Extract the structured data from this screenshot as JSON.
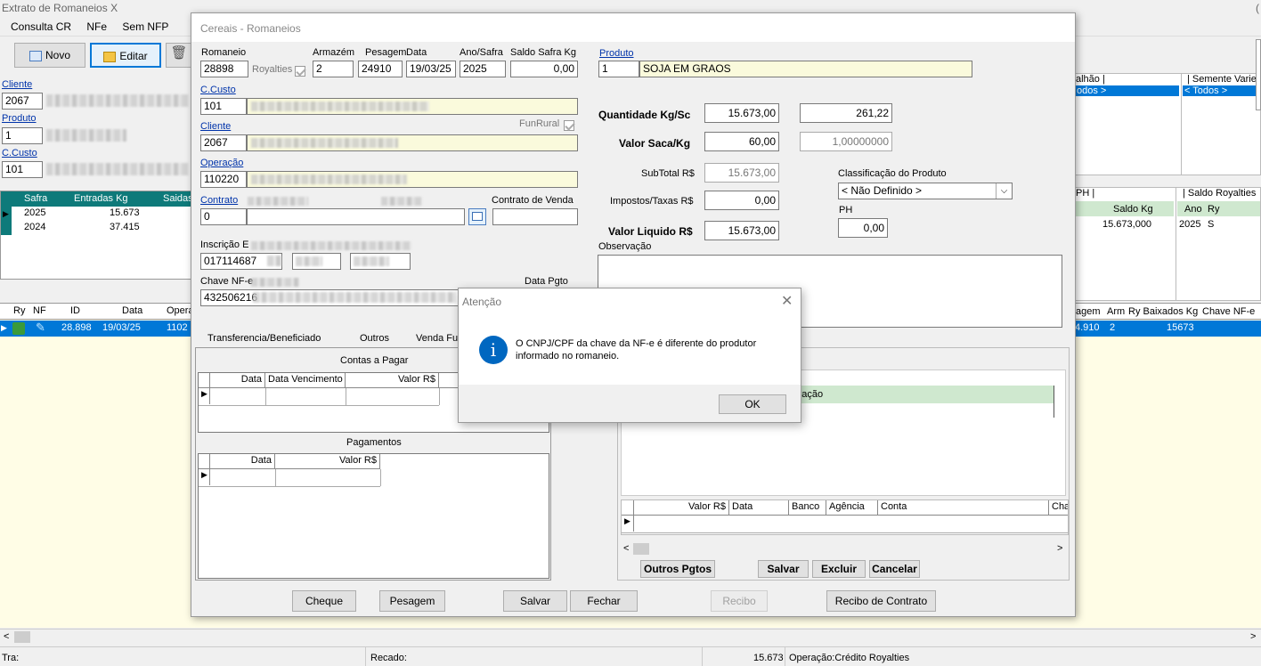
{
  "main": {
    "title": "Extrato de Romaneios X",
    "menu": [
      "Consulta CR",
      "NFe",
      "Sem NFP"
    ],
    "btn_novo": "Novo",
    "btn_editar": "Editar",
    "cliente_label": "Cliente",
    "cliente_code": "2067",
    "produto_label": "Produto",
    "produto_code": "1",
    "ccusto_label": "C.Custo",
    "ccusto_code": "101",
    "safra_headers": [
      "Safra",
      "Entradas Kg",
      "Saidas"
    ],
    "safra_rows": [
      [
        "2025",
        "15.673"
      ],
      [
        "2024",
        "37.415"
      ]
    ],
    "grid_headers": [
      "Ry",
      "NF",
      "ID",
      "Data",
      "Opera"
    ],
    "grid_row": [
      "28.898",
      "19/03/25",
      "1102"
    ],
    "right_hdr_talhao": "alhão |",
    "right_hdr_semente": "| Semente Varie",
    "right_todos1": "odos >",
    "right_todos2": "< Todos >",
    "right_ph": "PH |",
    "right_saldo_roy": "| Saldo Royalties",
    "right_saldo_kg": "Saldo Kg",
    "right_ano": "Ano",
    "right_ry": "Ry",
    "right_saldo_val": "15.673,000",
    "right_ano_val": "2025",
    "right_ry_val": "S",
    "right_grid_headers": [
      "agem",
      "Arm",
      "Ry Baixados Kg",
      "Chave NF-e"
    ],
    "right_grid_row": [
      "4.910",
      "2",
      "15673"
    ],
    "status_tra": "Tra:",
    "status_recado": "Recado:",
    "status_qty": "15.673",
    "status_oper": "Operação:Crédito Royalties"
  },
  "win": {
    "title": "Cereais - Romaneios",
    "romaneio_label": "Romaneio",
    "romaneio": "28898",
    "royalties_label": "Royalties",
    "armazem_label": "Armazém",
    "armazem": "2",
    "pesagem_label": "Pesagem",
    "pesagem": "24910",
    "data_label": "Data",
    "data": "19/03/25",
    "anosafra_label": "Ano/Safra",
    "anosafra": "2025",
    "saldo_label": "Saldo Safra Kg",
    "saldo": "0,00",
    "ccusto_label": "C.Custo",
    "ccusto": "101",
    "cliente_label": "Cliente",
    "cliente": "2067",
    "funrural_label": "FunRural",
    "operacao_label": "Operação",
    "operacao": "110220",
    "contrato_label": "Contrato",
    "contrato": "0",
    "contrato_venda_label": "Contrato de Venda",
    "inscricao_label": "Inscrição E",
    "inscricao": "017114687",
    "chave_label": "Chave NF-e",
    "chave": "432506216",
    "datapgto_label": "Data Pgto",
    "produto_label": "Produto",
    "produto_code": "1",
    "produto_name": "SOJA EM GRAOS",
    "qtd_label": "Quantidade Kg/Sc",
    "qtd_kg": "15.673,00",
    "qtd_sc": "261,22",
    "valor_saca_label": "Valor Saca/Kg",
    "valor_saca": "60,00",
    "valor_kg": "1,00000000",
    "subtotal_label": "SubTotal R$",
    "subtotal": "15.673,00",
    "impostos_label": "Impostos/Taxas R$",
    "impostos": "0,00",
    "liquido_label": "Valor Liquido R$",
    "liquido": "15.673,00",
    "classif_label": "Classificação do Produto",
    "classif_value": "< Não Definido >",
    "ph_label": "PH",
    "ph": "0,00",
    "obs_label": "Observação",
    "tabs": [
      "Transferencia/Beneficiado",
      "Outros",
      "Venda Fu"
    ],
    "contas_title": "Contas a Pagar",
    "contas_headers": [
      "Data",
      "Data Vencimento",
      "Valor R$"
    ],
    "pag_title": "Pagamentos",
    "pag_headers": [
      "Data",
      "Valor R$"
    ],
    "obs_grid_cell": "ervação",
    "pgto_headers": [
      "Valor R$",
      "Data",
      "Banco",
      "Agência",
      "Conta",
      "Cha"
    ],
    "btn_outros": "Outros Pgtos",
    "btn_salvar2": "Salvar",
    "btn_excluir": "Excluir",
    "btn_cancelar": "Cancelar",
    "btn_cheque": "Cheque",
    "btn_pesagem": "Pesagem",
    "btn_salvar": "Salvar",
    "btn_fechar": "Fechar",
    "btn_recibo": "Recibo",
    "btn_recibo_contrato": "Recibo de Contrato"
  },
  "dialog": {
    "title": "Atenção",
    "message": "O CNPJ/CPF da chave da NF-e é diferente do produtor informado no romaneio.",
    "ok": "OK"
  },
  "colors": {
    "teal": "#0e7a7a",
    "select_blue": "#0078d7",
    "pale_yellow": "#fffde6",
    "field_yellow": "#fafadc",
    "green_row": "#cfe8cf",
    "info_blue": "#0067c0"
  }
}
